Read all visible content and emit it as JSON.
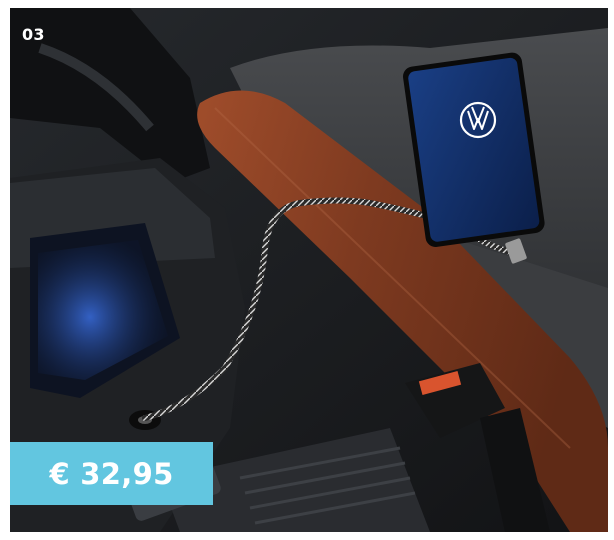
{
  "product": {
    "item_number": "03",
    "price": "€ 32,95",
    "brand_logo": "vw-logo-icon"
  },
  "colors": {
    "price_badge": "#62c6e0",
    "leather": "#8a3f22",
    "phone_screen": "#12306e"
  }
}
